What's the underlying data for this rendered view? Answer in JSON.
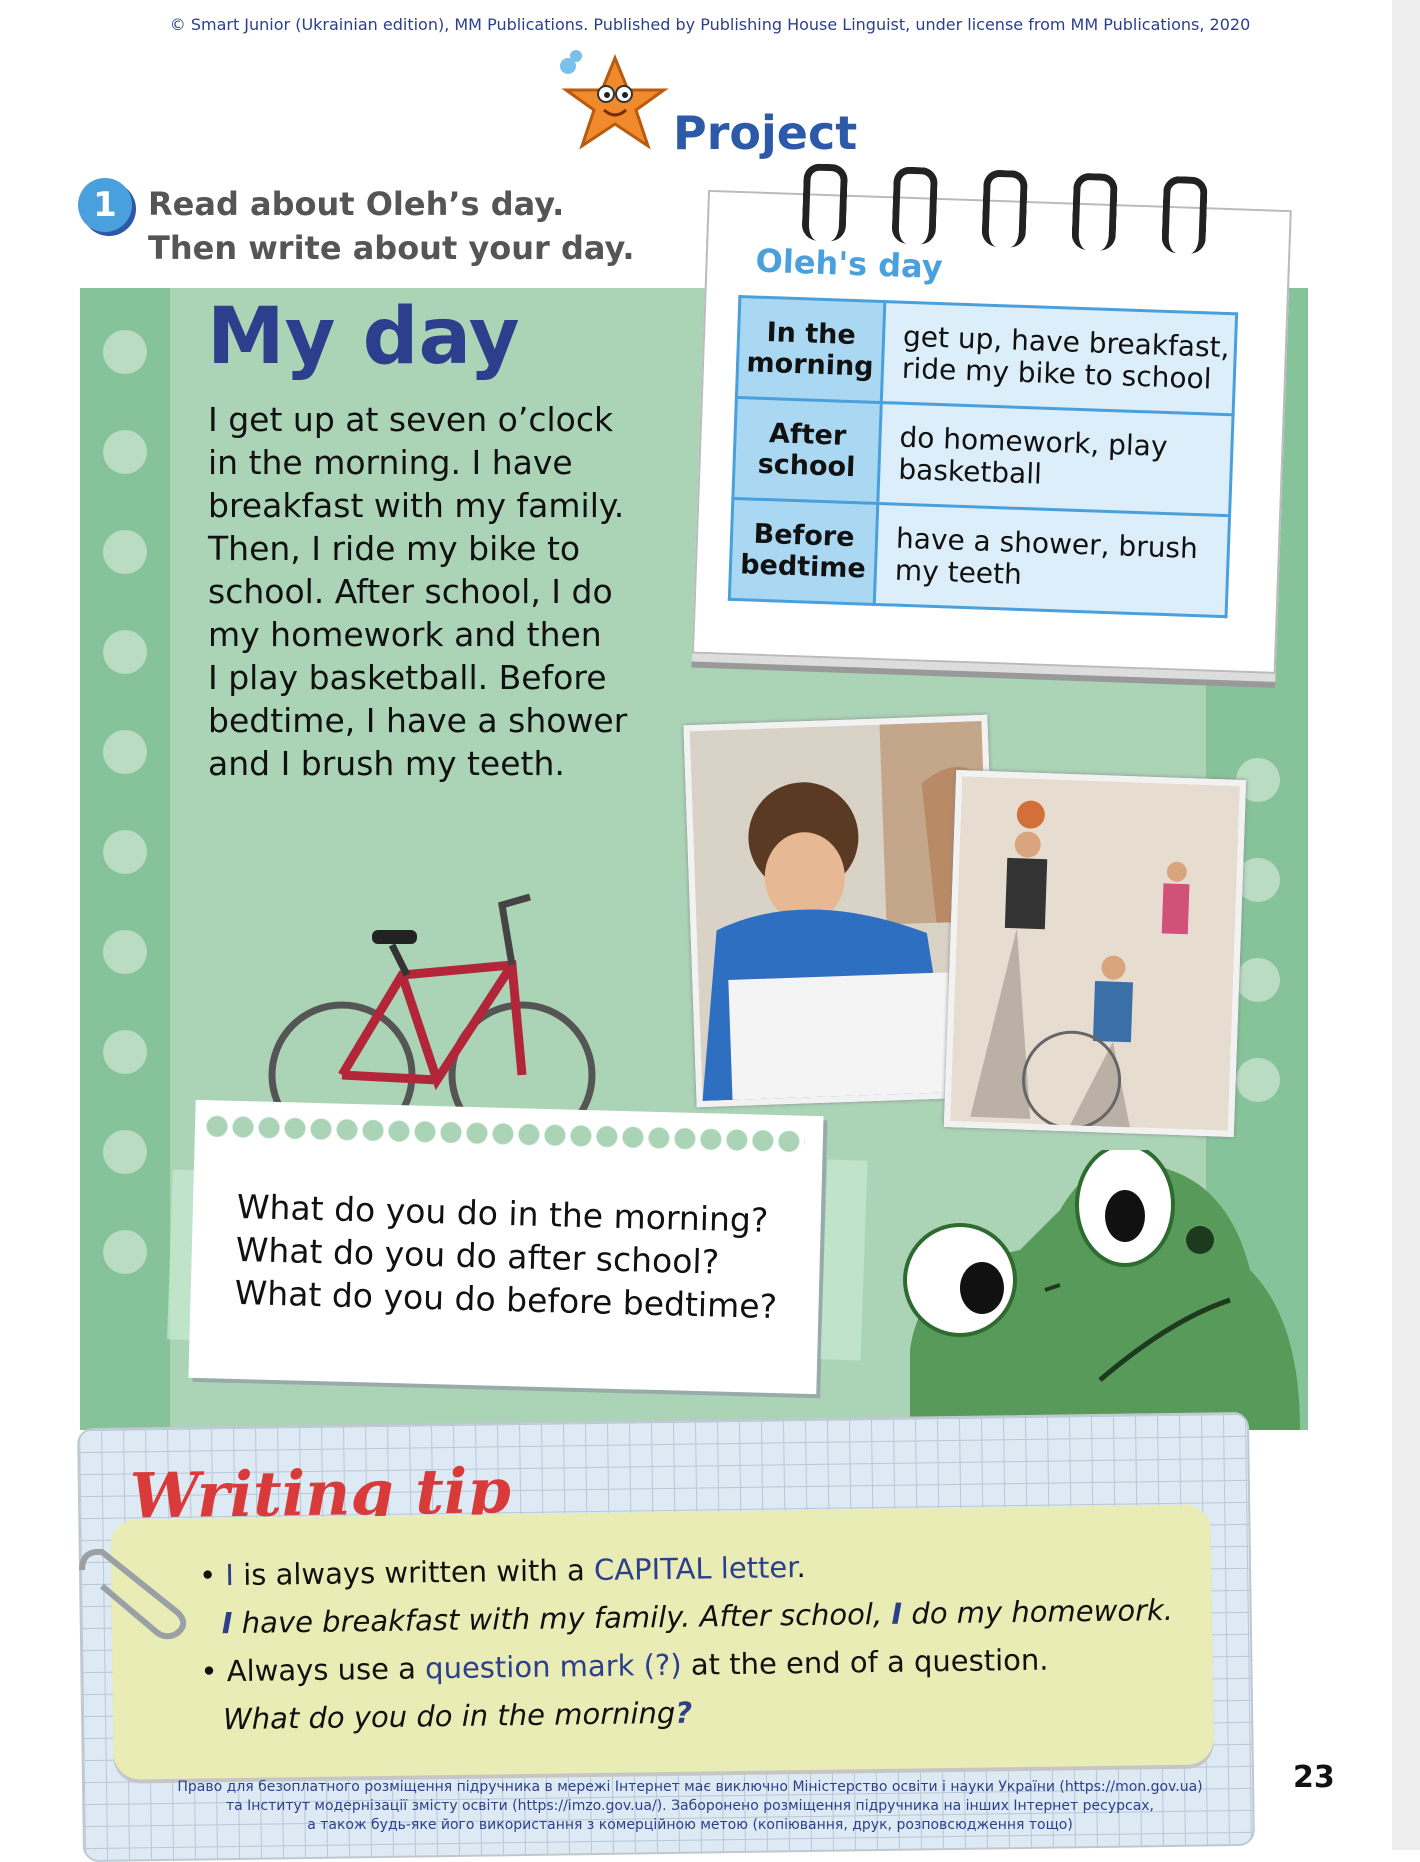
{
  "copyright": "© Smart Junior (Ukrainian edition), MM Publications. Published by Publishing House Linguist, under license from MM Publications, 2020",
  "section_title": "Project",
  "task": {
    "number": "1",
    "instruction": "Read about Oleh’s day.\nThen write about your day."
  },
  "my_day": {
    "title": "My day",
    "lines": [
      "I get up at seven o’clock",
      "in the morning. I have",
      "breakfast with my family.",
      "Then, I ride my bike to",
      "school. After school, I do",
      "my homework and then",
      "I play basketball. Before",
      "bedtime, I have a shower",
      "and I brush my teeth."
    ]
  },
  "schedule": {
    "title": "Oleh's day",
    "rows": [
      {
        "time": "In the morning",
        "activities": "get up, have breakfast, ride my bike to school"
      },
      {
        "time": "After school",
        "activities": "do homework, play basketball"
      },
      {
        "time": "Before bedtime",
        "activities": "have a shower, brush my teeth"
      }
    ]
  },
  "questions": [
    "What do you do in the morning?",
    "What do you do after school?",
    "What do you do before bedtime?"
  ],
  "writing_tip": {
    "title": "Writing tip",
    "rule1": {
      "highlight": "I",
      "text": " is always written with a ",
      "term": "CAPITAL letter",
      "end": "."
    },
    "example1": {
      "pre": "I",
      "mid": " have breakfast with my family. After school, ",
      "cap": "I",
      "post": " do my homework."
    },
    "rule2": {
      "text": "Always use a ",
      "term": "question mark (?)",
      "end": " at the end of a question."
    },
    "example2": {
      "text": "What do you do in the morning",
      "mark": "?"
    }
  },
  "footer": [
    "Право для безоплатного розміщення підручника в мережі Інтернет має виключно Міністерство освіти і науки України (https://mon.gov.ua)",
    "та Інститут модернізації змісту освіти (https://imzo.gov.ua/). Заборонено розміщення підручника на інших Інтернет ресурсах,",
    "а також будь-яке його використання з комерційною метою (копіювання, друк, розповсюдження тощо)"
  ],
  "page_number": "23"
}
